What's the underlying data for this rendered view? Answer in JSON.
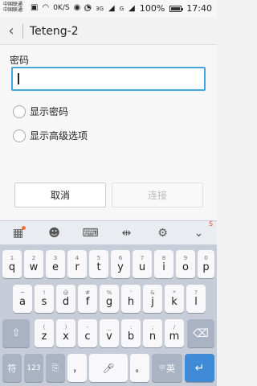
{
  "status_bar": {
    "carrier_top": "中国联通",
    "carrier_bottom": "中国联通",
    "speed": "0K/S",
    "signal_3g": "3G",
    "signal_g": "G",
    "battery_percent": "100%",
    "time": "17:40"
  },
  "header": {
    "title": "Teteng-2"
  },
  "form": {
    "password_label": "密码",
    "password_value": "",
    "show_password_label": "显示密码",
    "show_advanced_label": "显示高级选项",
    "cancel_label": "取消",
    "connect_label": "连接"
  },
  "keyboard": {
    "row1": [
      {
        "sym": "1",
        "ch": "q"
      },
      {
        "sym": "2",
        "ch": "w"
      },
      {
        "sym": "3",
        "ch": "e"
      },
      {
        "sym": "4",
        "ch": "r"
      },
      {
        "sym": "5",
        "ch": "t"
      },
      {
        "sym": "6",
        "ch": "y"
      },
      {
        "sym": "7",
        "ch": "u"
      },
      {
        "sym": "8",
        "ch": "i"
      },
      {
        "sym": "9",
        "ch": "o"
      },
      {
        "sym": "0",
        "ch": "p"
      }
    ],
    "row2": [
      {
        "sym": "~",
        "ch": "a"
      },
      {
        "sym": "!",
        "ch": "s"
      },
      {
        "sym": "@",
        "ch": "d"
      },
      {
        "sym": "#",
        "ch": "f"
      },
      {
        "sym": "%",
        "ch": "g"
      },
      {
        "sym": "'",
        "ch": "h"
      },
      {
        "sym": "&",
        "ch": "j"
      },
      {
        "sym": "*",
        "ch": "k"
      },
      {
        "sym": "?",
        "ch": "l"
      }
    ],
    "row3": [
      {
        "sym": "(",
        "ch": "z"
      },
      {
        "sym": ")",
        "ch": "x"
      },
      {
        "sym": "-",
        "ch": "c"
      },
      {
        "sym": "_",
        "ch": "v"
      },
      {
        "sym": ":",
        "ch": "b"
      },
      {
        "sym": ";",
        "ch": "n"
      },
      {
        "sym": "/",
        "ch": "m"
      }
    ],
    "symbol_key": "符",
    "number_key": "123",
    "comma_key": "，",
    "period_key": "。",
    "lang_key_zh": "中",
    "lang_key_en": "英"
  }
}
